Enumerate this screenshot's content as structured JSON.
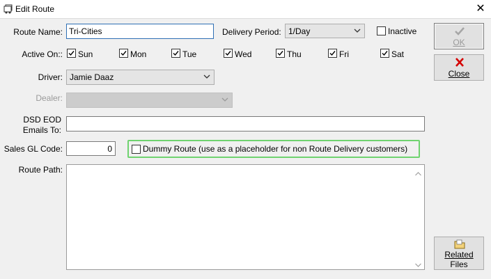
{
  "window": {
    "title": "Edit Route",
    "close_glyph": "✕"
  },
  "form": {
    "route_name_label": "Route Name:",
    "route_name_value": "Tri-Cities",
    "delivery_period_label": "Delivery Period:",
    "delivery_period_value": "1/Day",
    "inactive_label": "Inactive",
    "inactive_checked": false,
    "active_on_label": "Active On::",
    "days": [
      {
        "label": "Sun",
        "checked": true
      },
      {
        "label": "Mon",
        "checked": true
      },
      {
        "label": "Tue",
        "checked": true
      },
      {
        "label": "Wed",
        "checked": true
      },
      {
        "label": "Thu",
        "checked": true
      },
      {
        "label": "Fri",
        "checked": true
      },
      {
        "label": "Sat",
        "checked": true
      }
    ],
    "driver_label": "Driver:",
    "driver_value": "Jamie Daaz",
    "dealer_label": "Dealer:",
    "dealer_value": "",
    "dsd_label_line1": "DSD EOD",
    "dsd_label_line2": "Emails To:",
    "dsd_value": "",
    "sales_gl_label": "Sales GL Code:",
    "sales_gl_value": "0",
    "dummy_route_label": "Dummy Route (use as a placeholder for non Route Delivery customers)",
    "dummy_route_checked": false,
    "route_path_label": "Route Path:",
    "route_path_value": ""
  },
  "buttons": {
    "ok_label": "OK",
    "close_label": "Close",
    "related_files_line1": "Related",
    "related_files_line2": "Files"
  },
  "colors": {
    "highlight": "#6fd36f",
    "focus_border": "#2f6fb5",
    "close_red": "#d40000"
  }
}
